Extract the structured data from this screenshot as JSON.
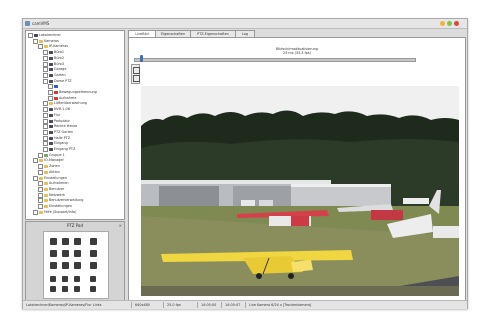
{
  "window": {
    "title": "camVMS"
  },
  "tabs": [
    {
      "label": "LiveBild",
      "active": true
    },
    {
      "label": "Eigenschaften",
      "active": false
    },
    {
      "label": "PTZ-Eigenschaften",
      "active": false
    },
    {
      "label": "Log",
      "active": false
    }
  ],
  "tree": [
    {
      "label": "Lokalrechner",
      "icon": "computer-icon",
      "depth": 0
    },
    {
      "label": "Kameras",
      "icon": "folder-icon",
      "depth": 1
    },
    {
      "label": "IP-Kameras",
      "icon": "folder-icon",
      "depth": 2
    },
    {
      "label": "Büro1",
      "icon": "camera-icon",
      "depth": 3
    },
    {
      "label": "Büro2",
      "icon": "camera-icon",
      "depth": 3
    },
    {
      "label": "Büro3",
      "icon": "camera-icon",
      "depth": 3
    },
    {
      "label": "Garage",
      "icon": "camera-icon",
      "depth": 3
    },
    {
      "label": "Garten",
      "icon": "camera-icon",
      "depth": 3
    },
    {
      "label": "Dome PTZ",
      "icon": "camera-icon",
      "depth": 3
    },
    {
      "label": "",
      "icon": "ptz-icon",
      "depth": 4
    },
    {
      "label": "Bewegungserkennung",
      "icon": "red-icon",
      "depth": 4
    },
    {
      "label": "Aufnahme",
      "icon": "red-icon",
      "depth": 4
    },
    {
      "label": "Lüfterüberwachung",
      "icon": "folder-icon",
      "depth": 3
    },
    {
      "label": "NVR-1.06",
      "icon": "camera-icon",
      "depth": 3
    },
    {
      "label": "Flur",
      "icon": "camera-icon",
      "depth": 3
    },
    {
      "label": "Parkplatz",
      "icon": "camera-icon",
      "depth": 3
    },
    {
      "label": "Rechte Hecke",
      "icon": "camera-icon",
      "depth": 3
    },
    {
      "label": "PTZ Garten",
      "icon": "camera-icon",
      "depth": 3
    },
    {
      "label": "Halle PTZ",
      "icon": "camera-icon",
      "depth": 3
    },
    {
      "label": "Eingang",
      "icon": "camera-icon",
      "depth": 3
    },
    {
      "label": "Eingang PTZ",
      "icon": "camera-icon",
      "depth": 3
    },
    {
      "label": "Gruppe 1",
      "icon": "group-icon",
      "depth": 2
    },
    {
      "label": "IO-Manager",
      "icon": "folder-icon",
      "depth": 1
    },
    {
      "label": "Zonen",
      "icon": "folder-icon",
      "depth": 2
    },
    {
      "label": "Aktion",
      "icon": "folder-icon",
      "depth": 2
    },
    {
      "label": "Einstellungen",
      "icon": "folder-icon",
      "depth": 1
    },
    {
      "label": "Aufnahmen",
      "icon": "folder-icon",
      "depth": 2
    },
    {
      "label": "Benutzer",
      "icon": "folder-icon",
      "depth": 2
    },
    {
      "label": "Netzwerk",
      "icon": "folder-icon",
      "depth": 2
    },
    {
      "label": "Benutzerverwaltung",
      "icon": "folder-icon",
      "depth": 2
    },
    {
      "label": "Einstellungen",
      "icon": "folder-icon",
      "depth": 2
    },
    {
      "label": "Hilfe (Support/Info)",
      "icon": "help-icon",
      "depth": 1
    }
  ],
  "ptz": {
    "title": "PTZ Pad"
  },
  "viewer": {
    "slider_caption_line1": "Bildschirmaktualisierung",
    "slider_caption_line2": "25 ms (33.3 fps)"
  },
  "status": {
    "left": "Lokalrechner/Kameras/IP-Kameras/Flur Links",
    "res": "640x480",
    "fps": "25.0 fps",
    "time": "14:05:00",
    "time2": "14:05:47",
    "info": "Live Kamera 6/24 x [Trockenkamera]"
  },
  "colors": {
    "accent": "#3f6fc0",
    "titlebar_bg": "#e6e6e6"
  }
}
